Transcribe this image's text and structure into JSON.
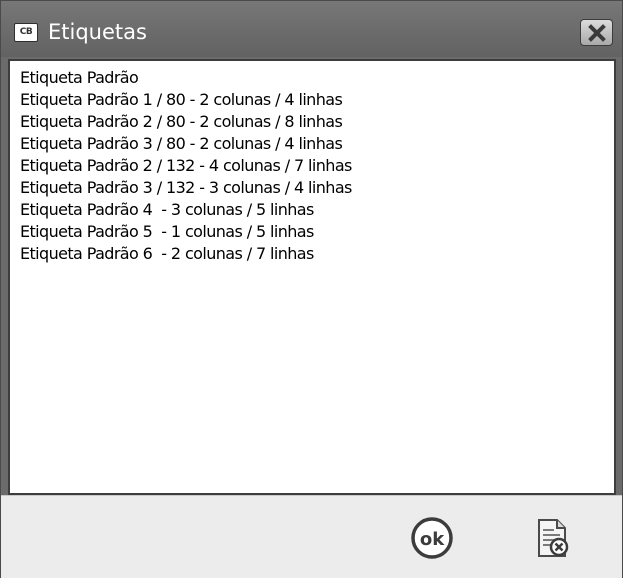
{
  "window": {
    "title": "Etiquetas",
    "app_icon_text": "CB"
  },
  "list": {
    "items": [
      "Etiqueta Padrão",
      "Etiqueta Padrão 1 / 80 - 2 colunas / 4 linhas",
      "Etiqueta Padrão 2 / 80 - 2 colunas / 8 linhas",
      "Etiqueta Padrão 3 / 80 - 2 colunas / 4 linhas",
      "Etiqueta Padrão 2 / 132 - 4 colunas / 7 linhas",
      "Etiqueta Padrão 3 / 132 - 3 colunas / 4 linhas",
      "Etiqueta Padrão 4  - 3 colunas / 5 linhas",
      "Etiqueta Padrão 5  - 1 colunas / 5 linhas",
      "Etiqueta Padrão 6  - 2 colunas / 7 linhas"
    ]
  },
  "footer": {
    "ok_label": "ok",
    "ok_icon": "ok-circle-icon",
    "cancel_icon": "document-cancel-icon"
  },
  "colors": {
    "titlebar": "#6b6b6b",
    "title_text": "#ffffff",
    "list_background": "#ffffff",
    "footer_background": "#ececec"
  }
}
